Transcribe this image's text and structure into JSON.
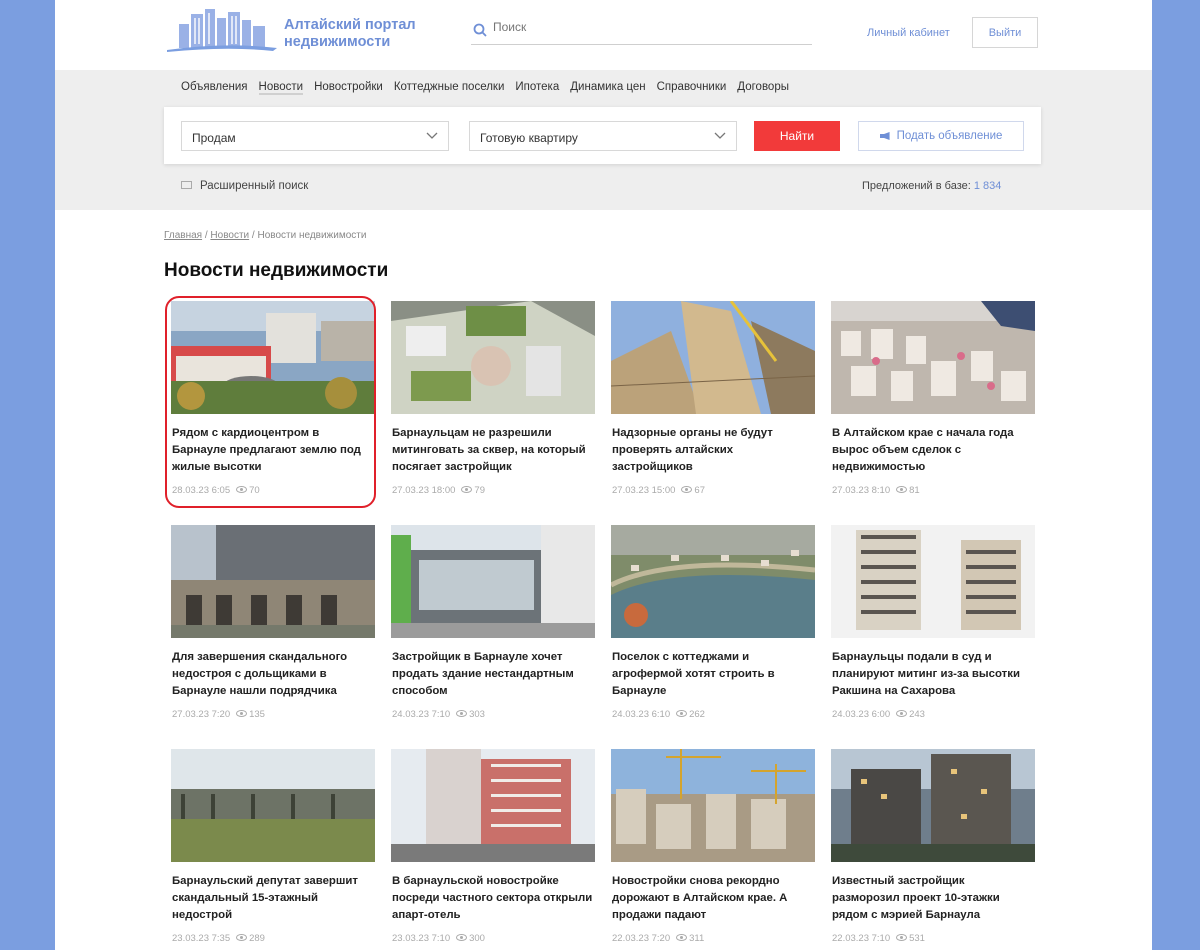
{
  "header": {
    "logo_line1": "Алтайский портал",
    "logo_line2": "недвижимости",
    "search_placeholder": "Поиск",
    "account_link": "Личный кабинет",
    "logout_button": "Выйти"
  },
  "nav": {
    "items": [
      {
        "label": "Объявления"
      },
      {
        "label": "Новости"
      },
      {
        "label": "Новостройки"
      },
      {
        "label": "Коттеджные поселки"
      },
      {
        "label": "Ипотека"
      },
      {
        "label": "Динамика цен"
      },
      {
        "label": "Справочники"
      },
      {
        "label": "Договоры"
      }
    ],
    "active": "Новости"
  },
  "filter": {
    "deal_type": "Продам",
    "property_type": "Готовую квартиру",
    "find_button": "Найти",
    "post_ad_button": "Подать объявление",
    "advanced_search": "Расширенный поиск",
    "offers_label": "Предложений в базе:",
    "offers_count": "1 834"
  },
  "breadcrumb": {
    "home": "Главная",
    "sep1": "/",
    "news": "Новости",
    "sep2": "/",
    "current": "Новости недвижимости"
  },
  "page_title": "Новости недвижимости",
  "news": [
    {
      "title": "Рядом с кардиоцентром в Барнауле предлагают землю под жилые высотки",
      "date": "28.03.23 6:05",
      "views": "70"
    },
    {
      "title": "Барнаульцам не разрешили митинговать за сквер, на который посягает застройщик",
      "date": "27.03.23 18:00",
      "views": "79"
    },
    {
      "title": "Надзорные органы не будут проверять алтайских застройщиков",
      "date": "27.03.23 15:00",
      "views": "67"
    },
    {
      "title": "В Алтайском крае с начала года вырос объем сделок с недвижимостью",
      "date": "27.03.23 8:10",
      "views": "81"
    },
    {
      "title": "Для завершения скандального недостроя с дольщиками в Барнауле нашли подрядчика",
      "date": "27.03.23 7:20",
      "views": "135"
    },
    {
      "title": "Застройщик в Барнауле хочет продать здание нестандартным способом",
      "date": "24.03.23 7:10",
      "views": "303"
    },
    {
      "title": "Поселок с коттеджами и агрофермой хотят строить в Барнауле",
      "date": "24.03.23 6:10",
      "views": "262"
    },
    {
      "title": "Барнаульцы подали в суд и планируют митинг из-за высотки Ракшина на Сахарова",
      "date": "24.03.23 6:00",
      "views": "243"
    },
    {
      "title": "Барнаульский депутат завершит скандальный 15-этажный недострой",
      "date": "23.03.23 7:35",
      "views": "289"
    },
    {
      "title": "В барнаульской новостройке посреди частного сектора открыли апарт-отель",
      "date": "23.03.23 7:10",
      "views": "300"
    },
    {
      "title": "Новостройки снова рекордно дорожают в Алтайском крае. А продажи падают",
      "date": "22.03.23 7:20",
      "views": "311"
    },
    {
      "title": "Известный застройщик разморозил проект 10-этажки рядом с мэрией Барнаула",
      "date": "22.03.23 7:10",
      "views": "531"
    }
  ]
}
